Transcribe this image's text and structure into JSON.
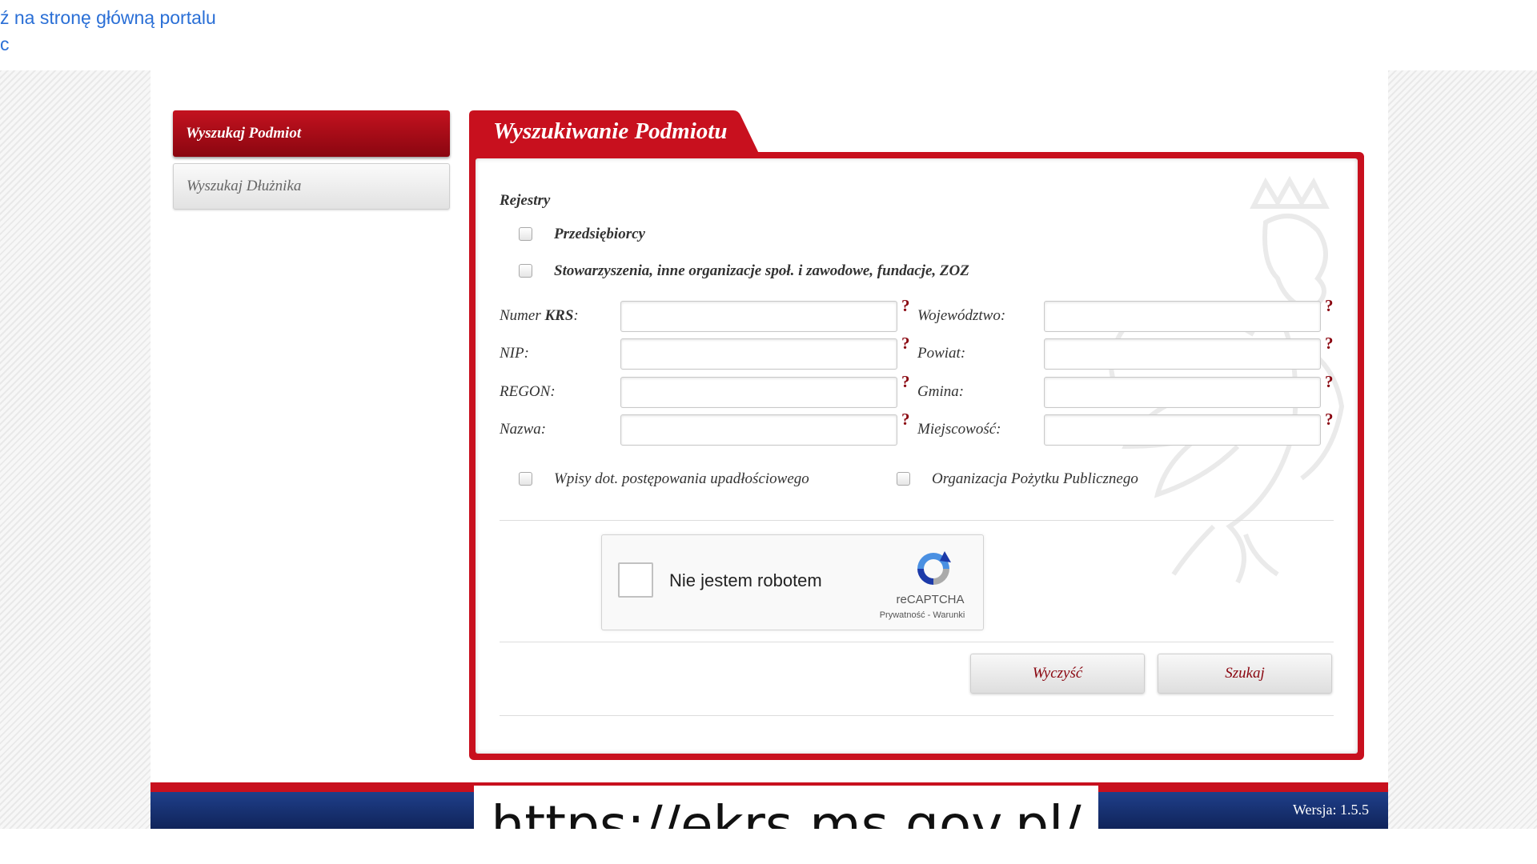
{
  "top_links": {
    "portal": "ź na stronę główną portalu",
    "second": "c"
  },
  "sidebar": {
    "items": [
      {
        "label": "Wyszukaj Podmiot",
        "active": true
      },
      {
        "label": "Wyszukaj Dłużnika",
        "active": false
      }
    ]
  },
  "panel": {
    "title": "Wyszukiwanie Podmiotu",
    "registries_label": "Rejestry",
    "registries": [
      {
        "label": "Przedsiębiorcy",
        "checked": false
      },
      {
        "label": "Stowarzyszenia, inne organizacje społ. i zawodowe, fundacje, ZOZ",
        "checked": false
      }
    ],
    "fields_left": [
      {
        "label_prefix": "Numer ",
        "label_bold": "KRS",
        "label_suffix": ":",
        "value": ""
      },
      {
        "label_prefix": "NIP:",
        "label_bold": "",
        "label_suffix": "",
        "value": ""
      },
      {
        "label_prefix": "REGON:",
        "label_bold": "",
        "label_suffix": "",
        "value": ""
      },
      {
        "label_prefix": "Nazwa:",
        "label_bold": "",
        "label_suffix": "",
        "value": ""
      }
    ],
    "fields_right": [
      {
        "label": "Województwo:",
        "value": ""
      },
      {
        "label": "Powiat:",
        "value": ""
      },
      {
        "label": "Gmina:",
        "value": ""
      },
      {
        "label": "Miejscowość:",
        "value": ""
      }
    ],
    "help_symbol": "?",
    "options": [
      {
        "label": "Wpisy dot. postępowania upadłościowego",
        "checked": false
      },
      {
        "label": "Organizacja Pożytku Publicznego",
        "checked": false
      }
    ],
    "recaptcha": {
      "label": "Nie jestem robotem",
      "brand": "reCAPTCHA",
      "terms": "Prywatność - Warunki"
    },
    "buttons": {
      "clear": "Wyczyść",
      "search": "Szukaj"
    }
  },
  "footer": {
    "version": "Wersja: 1.5.5"
  },
  "url_banner": "https://ekrs.ms.gov.pl/",
  "colors": {
    "accent_red": "#c8101e",
    "dark_red": "#8a0610",
    "footer_blue": "#1f3f8a",
    "link_blue": "#2a6fd6"
  }
}
